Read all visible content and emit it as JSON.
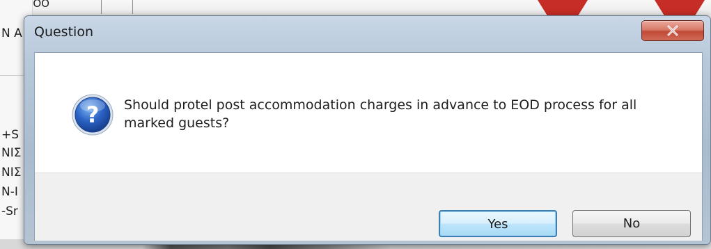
{
  "background": {
    "left_fragments": [
      "+S",
      "ΝΙΣ",
      "ΝΙΣ",
      "N-I",
      "-Sr"
    ],
    "top_fragment": "ΛΑΙΝ  ΙΟΟ",
    "left_top_fragment": "Ν Α",
    "accent_red": "#c62d26"
  },
  "dialog": {
    "title": "Question",
    "icon": "question-icon",
    "message": "Should protel post accommodation charges in advance to EOD process for all marked guests?",
    "close_icon": "close-icon",
    "buttons": {
      "yes": "Yes",
      "no": "No"
    },
    "default_button": "yes",
    "accent_color": "#3c7fb1"
  }
}
